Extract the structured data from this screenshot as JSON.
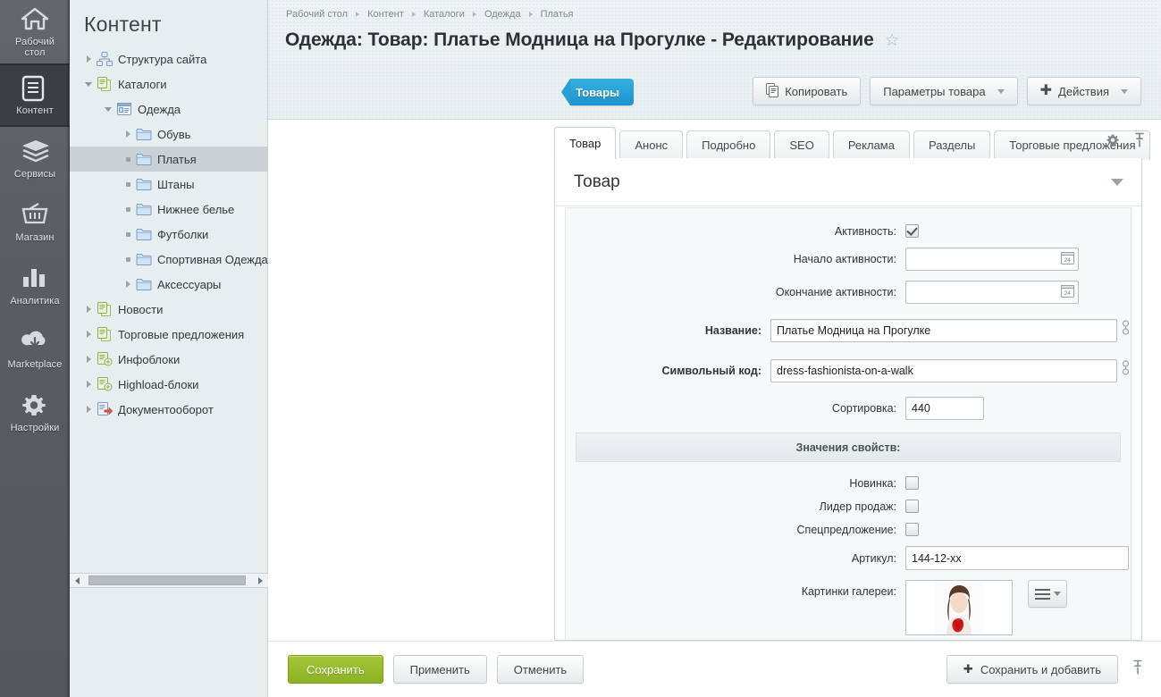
{
  "leftnav": {
    "items": [
      {
        "label": "Рабочий\nстол",
        "icon": "home-icon",
        "name": "desktop",
        "active": false
      },
      {
        "label": "Контент",
        "icon": "content-icon",
        "name": "content",
        "active": true
      },
      {
        "label": "Сервисы",
        "icon": "services-icon",
        "name": "services",
        "active": false
      },
      {
        "label": "Магазин",
        "icon": "shop-icon",
        "name": "shop",
        "active": false
      },
      {
        "label": "Аналитика",
        "icon": "analytics-icon",
        "name": "analytics",
        "active": false
      },
      {
        "label": "Marketplace",
        "icon": "marketplace-icon",
        "name": "marketplace",
        "active": false
      },
      {
        "label": "Настройки",
        "icon": "settings-icon",
        "name": "settings",
        "active": false
      }
    ]
  },
  "tree": {
    "title": "Контент",
    "nodes": [
      {
        "label": "Структура сайта",
        "indent": 0,
        "arrow": "right",
        "icon": "sitemap-icon",
        "selected": false
      },
      {
        "label": "Каталоги",
        "indent": 0,
        "arrow": "down",
        "icon": "iblock-icon",
        "selected": false
      },
      {
        "label": "Одежда",
        "indent": 1,
        "arrow": "down",
        "icon": "catalog-icon",
        "selected": false
      },
      {
        "label": "Обувь",
        "indent": 2,
        "arrow": "right",
        "icon": "folder-icon",
        "selected": false
      },
      {
        "label": "Платья",
        "indent": 2,
        "arrow": "dot",
        "icon": "folder-icon",
        "selected": true
      },
      {
        "label": "Штаны",
        "indent": 2,
        "arrow": "dot",
        "icon": "folder-icon",
        "selected": false
      },
      {
        "label": "Нижнее белье",
        "indent": 2,
        "arrow": "dot",
        "icon": "folder-icon",
        "selected": false
      },
      {
        "label": "Футболки",
        "indent": 2,
        "arrow": "dot",
        "icon": "folder-icon",
        "selected": false
      },
      {
        "label": "Спортивная Одежда",
        "indent": 2,
        "arrow": "dot",
        "icon": "folder-icon",
        "selected": false
      },
      {
        "label": "Аксессуары",
        "indent": 2,
        "arrow": "right",
        "icon": "folder-icon",
        "selected": false
      },
      {
        "label": "Новости",
        "indent": 0,
        "arrow": "right",
        "icon": "iblock-icon",
        "selected": false
      },
      {
        "label": "Торговые предложения",
        "indent": 0,
        "arrow": "right",
        "icon": "iblock-icon",
        "selected": false
      },
      {
        "label": "Инфоблоки",
        "indent": 0,
        "arrow": "right",
        "icon": "infoblock-icon",
        "selected": false
      },
      {
        "label": "Highload-блоки",
        "indent": 0,
        "arrow": "right",
        "icon": "infoblock-icon",
        "selected": false
      },
      {
        "label": "Документооборот",
        "indent": 0,
        "arrow": "right",
        "icon": "workflow-icon",
        "selected": false
      }
    ]
  },
  "breadcrumb": [
    "Рабочий стол",
    "Контент",
    "Каталоги",
    "Одежда",
    "Платья"
  ],
  "header": {
    "title": "Одежда: Товар: Платье Модница на Прогулке - Редактирование",
    "star": "☆"
  },
  "toolbar": {
    "tag_label": "Товары",
    "copy_label": "Копировать",
    "params_label": "Параметры товара",
    "actions_label": "Действия"
  },
  "tabs": [
    {
      "label": "Товар",
      "active": true
    },
    {
      "label": "Анонс",
      "active": false
    },
    {
      "label": "Подробно",
      "active": false
    },
    {
      "label": "SEO",
      "active": false
    },
    {
      "label": "Реклама",
      "active": false
    },
    {
      "label": "Разделы",
      "active": false
    },
    {
      "label": "Торговые предложения",
      "active": false
    }
  ],
  "card": {
    "title": "Товар",
    "fields": {
      "active_label": "Активность:",
      "active_checked": true,
      "date_start_label": "Начало активности:",
      "date_start_value": "",
      "date_end_label": "Окончание активности:",
      "date_end_value": "",
      "name_label": "Название:",
      "name_value": "Платье Модница на Прогулке",
      "code_label": "Символьный код:",
      "code_value": "dress-fashionista-on-a-walk",
      "sort_label": "Сортировка:",
      "sort_value": "440"
    },
    "properties_header": "Значения свойств:",
    "properties": {
      "new_label": "Новинка:",
      "new_checked": false,
      "bestseller_label": "Лидер продаж:",
      "bestseller_checked": false,
      "special_label": "Спецпредложение:",
      "special_checked": false,
      "article_label": "Артикул:",
      "article_value": "144-12-xx",
      "gallery_label": "Картинки галереи:"
    }
  },
  "footer": {
    "save_label": "Сохранить",
    "apply_label": "Применить",
    "cancel_label": "Отменить",
    "save_add_label": "Сохранить и добавить"
  },
  "colors": {
    "accent_blue": "#1e93cd",
    "save_green": "#8cb122",
    "nav_bg": "#5a5d64",
    "tree_bg": "#e7eef0"
  }
}
